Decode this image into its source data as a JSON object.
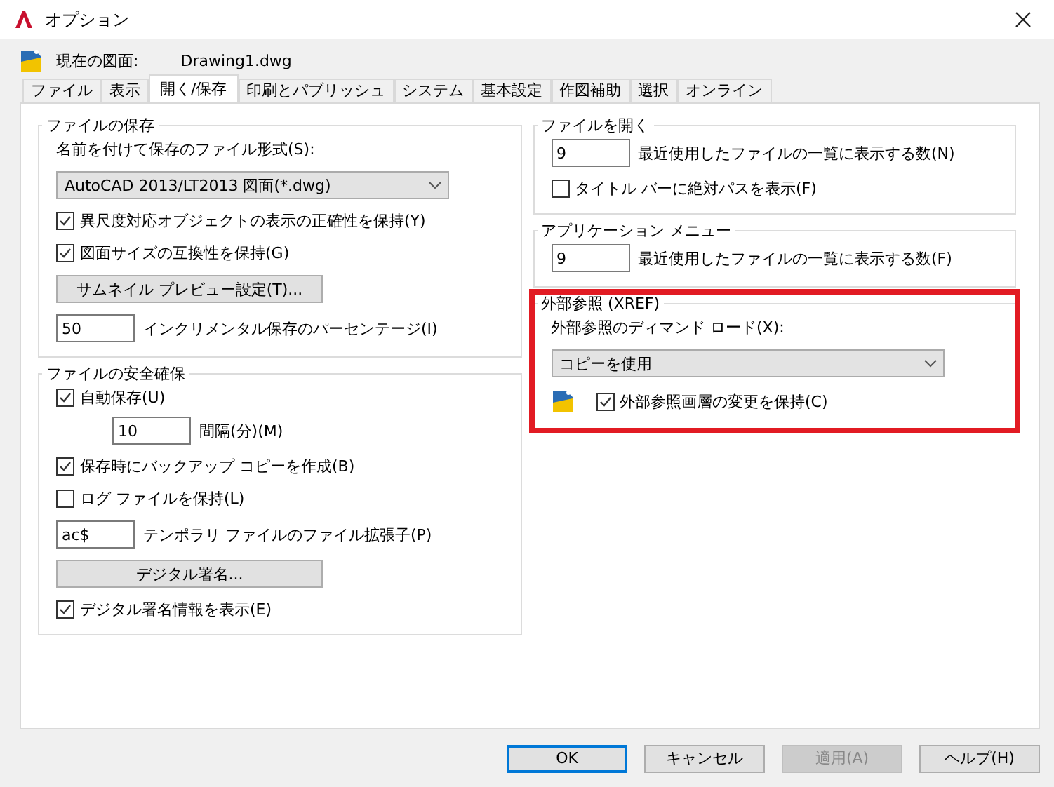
{
  "window": {
    "title": "オプション"
  },
  "drawing": {
    "label": "現在の図面:",
    "value": "Drawing1.dwg"
  },
  "tabs": [
    {
      "label": "ファイル",
      "selected": false
    },
    {
      "label": "表示",
      "selected": false
    },
    {
      "label": "開く/保存",
      "selected": true
    },
    {
      "label": "印刷とパブリッシュ",
      "selected": false
    },
    {
      "label": "システム",
      "selected": false
    },
    {
      "label": "基本設定",
      "selected": false
    },
    {
      "label": "作図補助",
      "selected": false
    },
    {
      "label": "選択",
      "selected": false
    },
    {
      "label": "オンライン",
      "selected": false
    }
  ],
  "columns": [
    {
      "groups": [
        {
          "title": "ファイルの保存",
          "highlighted": false,
          "items": [
            {
              "kind": "label",
              "label": "名前を付けて保存のファイル形式(S):"
            },
            {
              "kind": "select",
              "value": "AutoCAD 2013/LT2013 図面(*.dwg)"
            },
            {
              "kind": "checkbox",
              "label": "異尺度対応オブジェクトの表示の正確性を保持(Y)",
              "checked": true
            },
            {
              "kind": "checkbox",
              "label": "図面サイズの互換性を保持(G)",
              "checked": true
            },
            {
              "kind": "button",
              "label": "サムネイル プレビュー設定(T)..."
            },
            {
              "kind": "number",
              "value": "50",
              "caption": "インクリメンタル保存のパーセンテージ(I)"
            }
          ]
        },
        {
          "title": "ファイルの安全確保",
          "highlighted": false,
          "items": [
            {
              "kind": "checkbox",
              "label": "自動保存(U)",
              "checked": true,
              "children": [
                {
                  "kind": "number",
                  "value": "10",
                  "caption": "間隔(分)(M)"
                }
              ]
            },
            {
              "kind": "checkbox",
              "label": "保存時にバックアップ コピーを作成(B)",
              "checked": true
            },
            {
              "kind": "checkbox",
              "label": "ログ ファイルを保持(L)",
              "checked": false
            },
            {
              "kind": "number",
              "value": "ac$",
              "caption": "テンポラリ ファイルのファイル拡張子(P)"
            },
            {
              "kind": "button",
              "label": "デジタル署名..."
            },
            {
              "kind": "checkbox",
              "label": "デジタル署名情報を表示(E)",
              "checked": true
            }
          ]
        }
      ]
    },
    {
      "groups": [
        {
          "title": "ファイルを開く",
          "highlighted": false,
          "items": [
            {
              "kind": "number",
              "value": "9",
              "caption": "最近使用したファイルの一覧に表示する数(N)"
            },
            {
              "kind": "checkbox",
              "label": "タイトル バーに絶対パスを表示(F)",
              "checked": false
            }
          ]
        },
        {
          "title": "アプリケーション メニュー",
          "highlighted": false,
          "items": [
            {
              "kind": "number",
              "value": "9",
              "caption": "最近使用したファイルの一覧に表示する数(F)"
            }
          ]
        },
        {
          "title": "外部参照 (XREF)",
          "highlighted": true,
          "items": [
            {
              "kind": "label",
              "label": "外部参照のディマンド ロード(X):"
            },
            {
              "kind": "select",
              "value": "コピーを使用"
            },
            {
              "kind": "icon-checkbox",
              "label": "外部参照画層の変更を保持(C)",
              "checked": true
            }
          ]
        }
      ]
    }
  ],
  "buttons": [
    {
      "label": "OK",
      "kind": "default",
      "disabled": false
    },
    {
      "label": "キャンセル",
      "kind": "normal",
      "disabled": false
    },
    {
      "label": "適用(A)",
      "kind": "normal",
      "disabled": true
    },
    {
      "label": "ヘルプ(H)",
      "kind": "normal",
      "disabled": false
    }
  ]
}
